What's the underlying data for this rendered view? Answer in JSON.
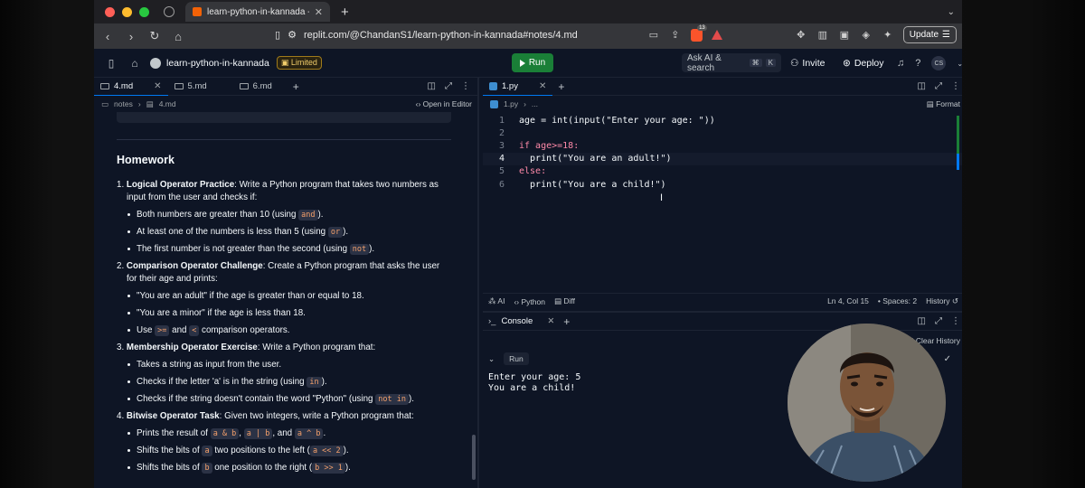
{
  "browser": {
    "tab_title": "learn-python-in-kannada - R",
    "url": "replit.com/@ChandanS1/learn-python-in-kannada#notes/4.md",
    "brave_badge": "13",
    "update_label": "Update"
  },
  "header": {
    "repl_name": "learn-python-in-kannada",
    "plan_badge": "Limited",
    "run_label": "Run",
    "ask_ai_label": "Ask AI & search",
    "ask_ai_kbd1": "⌘",
    "ask_ai_kbd2": "K",
    "invite_label": "Invite",
    "deploy_label": "Deploy",
    "avatar_initials": "CS"
  },
  "left_pane": {
    "tabs": [
      {
        "label": "4.md"
      },
      {
        "label": "5.md"
      },
      {
        "label": "6.md"
      }
    ],
    "crumb_folder": "notes",
    "crumb_file": "4.md",
    "open_in_editor": "Open in Editor",
    "doc": {
      "heading": "Homework",
      "items": [
        {
          "num": "1.",
          "title": "Logical Operator Practice",
          "text": ": Write a Python program that takes two numbers as input from the user and checks if:",
          "bullets": [
            {
              "pre": "Both numbers are greater than 10 (using ",
              "code": "and",
              "post": ")."
            },
            {
              "pre": "At least one of the numbers is less than 5 (using ",
              "code": "or",
              "post": ")."
            },
            {
              "pre": "The first number is not greater than the second (using ",
              "code": "not",
              "post": ")."
            }
          ]
        },
        {
          "num": "2.",
          "title": "Comparison Operator Challenge",
          "text": ": Create a Python program that asks the user for their age and prints:",
          "bullets": [
            {
              "pre": "\"You are an adult\" if the age is greater than or equal to 18.",
              "code": "",
              "post": ""
            },
            {
              "pre": "\"You are a minor\" if the age is less than 18.",
              "code": "",
              "post": ""
            },
            {
              "pre": "Use ",
              "code": ">=",
              "mid": " and ",
              "code2": "<",
              "post": " comparison operators."
            }
          ]
        },
        {
          "num": "3.",
          "title": "Membership Operator Exercise",
          "text": ": Write a Python program that:",
          "bullets": [
            {
              "pre": "Takes a string as input from the user.",
              "code": "",
              "post": ""
            },
            {
              "pre": "Checks if the letter 'a' is in the string (using ",
              "code": "in",
              "post": ")."
            },
            {
              "pre": "Checks if the string doesn't contain the word \"Python\" (using ",
              "code": "not in",
              "post": ")."
            }
          ]
        },
        {
          "num": "4.",
          "title": "Bitwise Operator Task",
          "text": ": Given two integers, write a Python program that:",
          "bullets": [
            {
              "pre": "Prints the result of ",
              "code": "a & b",
              "mid": ", ",
              "code2": "a | b",
              "mid2": ", and ",
              "code3": "a ^ b",
              "post": "."
            },
            {
              "pre": "Shifts the bits of ",
              "code": "a",
              "mid": " two positions to the left (",
              "code2": "a << 2",
              "post": ")."
            },
            {
              "pre": "Shifts the bits of ",
              "code": "b",
              "mid": " one position to the right (",
              "code2": "b >> 1",
              "post": ")."
            }
          ]
        }
      ]
    }
  },
  "editor": {
    "tab_label": "1.py",
    "crumb_file": "1.py",
    "crumb_more": "...",
    "format_label": "Format",
    "lines": [
      {
        "n": "1",
        "code": "age = int(input(\"Enter your age: \"))"
      },
      {
        "n": "2",
        "code": ""
      },
      {
        "n": "3",
        "code": "if age>=18:"
      },
      {
        "n": "4",
        "code": "  print(\"You are an adult!\")"
      },
      {
        "n": "5",
        "code": "else:"
      },
      {
        "n": "6",
        "code": "  print(\"You are a child!\")"
      }
    ],
    "status": {
      "ai": "AI",
      "lang": "Python",
      "diff": "Diff",
      "position": "Ln 4, Col 15",
      "spaces": "Spaces: 2",
      "history": "History"
    }
  },
  "console": {
    "tab_label": "Console",
    "clear_history": "Clear History",
    "run_chip": "Run",
    "output": "Enter your age: 5\nYou are a child!"
  }
}
